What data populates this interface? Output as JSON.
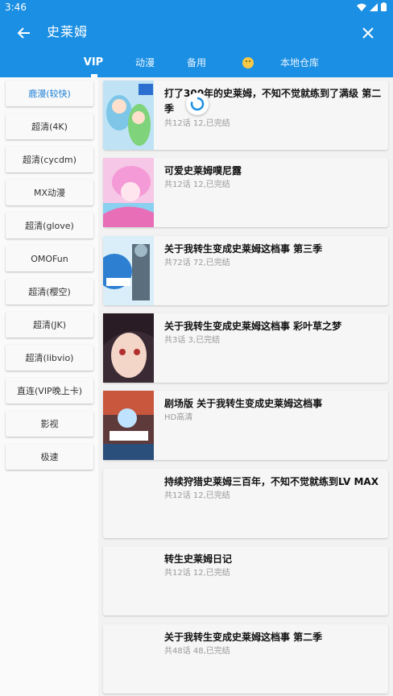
{
  "status": {
    "time": "3:46"
  },
  "header": {
    "title": "史莱姆"
  },
  "tabs": [
    {
      "label": "VIP",
      "active": true
    },
    {
      "label": "动漫"
    },
    {
      "label": "备用"
    },
    {
      "label": "",
      "icon": "smile-emoji-icon"
    },
    {
      "label": "本地仓库"
    }
  ],
  "sidebar": {
    "items": [
      {
        "label": "鹿漫(较快)",
        "active": true
      },
      {
        "label": "超清(4K)"
      },
      {
        "label": "超清(cycdm)"
      },
      {
        "label": "MX动漫"
      },
      {
        "label": "超清(glove)"
      },
      {
        "label": "OMOFun"
      },
      {
        "label": "超清(樱空)"
      },
      {
        "label": "超清(JK)"
      },
      {
        "label": "超清(libvio)"
      },
      {
        "label": "直连(VIP晚上卡)"
      },
      {
        "label": "影视"
      },
      {
        "label": "极速"
      }
    ]
  },
  "results": [
    {
      "title": "打了300年的史莱姆，不知不觉就练到了满级 第二季",
      "subtitle": "共12话 12,已完结"
    },
    {
      "title": "可爱史莱姆噗尼露",
      "subtitle": "共12话 12,已完结"
    },
    {
      "title": "关于我转生变成史莱姆这档事 第三季",
      "subtitle": "共72话 72,已完结"
    },
    {
      "title": "关于我转生变成史莱姆这档事 彩叶草之梦",
      "subtitle": "共3话 3,已完结"
    },
    {
      "title": "剧场版 关于我转生变成史莱姆这档事",
      "subtitle": "HD高清"
    },
    {
      "title": "持续狩猎史莱姆三百年，不知不觉就练到LV MAX",
      "subtitle": "共12话 12,已完结"
    },
    {
      "title": "转生史莱姆日记",
      "subtitle": "共12话 12,已完结"
    },
    {
      "title": "关于我转生变成史莱姆这档事 第二季",
      "subtitle": "共48话 48,已完结"
    }
  ],
  "colors": {
    "primary": "#1a8fe3",
    "active_text": "#1a7fd6"
  }
}
